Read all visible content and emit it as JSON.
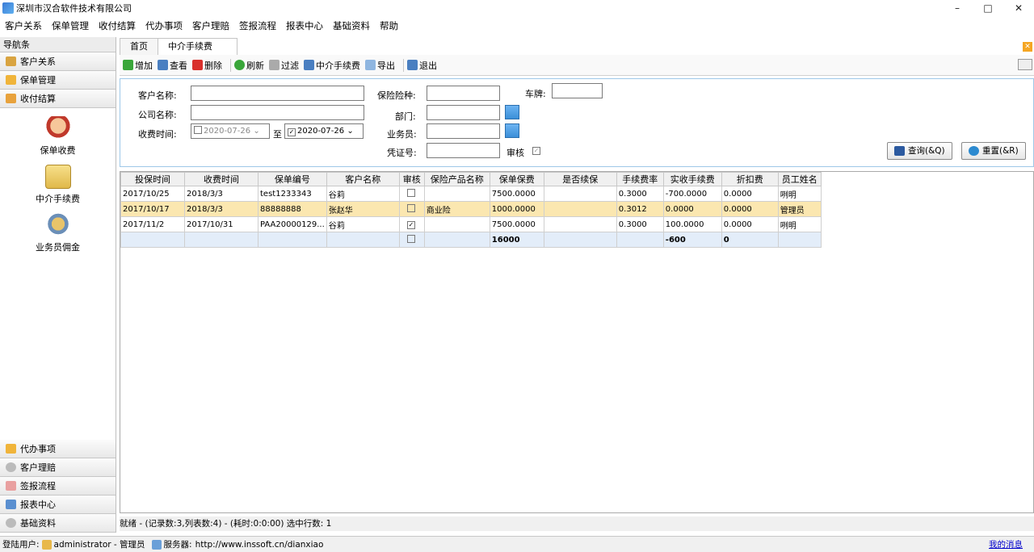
{
  "window": {
    "title": "深圳市汉合软件技术有限公司",
    "min": "–",
    "max": "□",
    "close": "✕"
  },
  "menu": [
    "客户关系",
    "保单管理",
    "收付结算",
    "代办事项",
    "客户理赔",
    "签报流程",
    "报表中心",
    "基础资料",
    "帮助"
  ],
  "nav": {
    "header": "导航条",
    "top_groups": [
      "客户关系",
      "保单管理",
      "收付结算"
    ],
    "sub_items": [
      "保单收费",
      "中介手续费",
      "业务员佣金"
    ],
    "bottom_groups": [
      "代办事项",
      "客户理赔",
      "签报流程",
      "报表中心",
      "基础资料"
    ]
  },
  "tabs": [
    "首页",
    "中介手续费"
  ],
  "toolbar": {
    "add": "增加",
    "view": "查看",
    "delete": "删除",
    "refresh": "刷新",
    "filter": "过滤",
    "print": "中介手续费",
    "export": "导出",
    "exit": "退出"
  },
  "filter": {
    "customer_name": "客户名称:",
    "company_name": "公司名称:",
    "fee_time": "收费时间:",
    "date_from": "2020-07-26",
    "to": "至",
    "date_to": "2020-07-26",
    "insurance_type": "保险险种:",
    "plate": "车牌:",
    "department": "部门:",
    "salesman": "业务员:",
    "voucher": "凭证号:",
    "audit": "审核",
    "query": "查询(&Q)",
    "reset": "重置(&R)"
  },
  "grid": {
    "columns": [
      "投保时间",
      "收费时间",
      "保单编号",
      "客户名称",
      "审核",
      "保险产品名称",
      "保单保费",
      "是否续保",
      "手续费率",
      "实收手续费",
      "折扣费",
      "员工姓名"
    ],
    "rows": [
      [
        "2017/10/25",
        "2018/3/3",
        "test1233343",
        "谷莉",
        "",
        "",
        "7500.0000",
        "",
        "0.3000",
        "-700.0000",
        "0.0000",
        "咧明"
      ],
      [
        "2017/10/17",
        "2018/3/3",
        "88888888",
        "张赵华",
        "",
        "商业险",
        "1000.0000",
        "",
        "0.3012",
        "0.0000",
        "0.0000",
        "管理员"
      ],
      [
        "2017/11/2",
        "2017/10/31",
        "PAA20000129...",
        "谷莉",
        "✓",
        "",
        "7500.0000",
        "",
        "0.3000",
        "100.0000",
        "0.0000",
        "咧明"
      ]
    ],
    "summary": [
      "",
      "",
      "",
      "",
      "",
      "",
      "16000",
      "",
      "",
      "-600",
      "0",
      ""
    ]
  },
  "status": "就绪 - (记录数:3,列表数:4) - (耗时:0:0:00) 选中行数: 1",
  "footer": {
    "login_label": "登陆用户:",
    "user": "administrator - 管理员",
    "server_label": "服务器:",
    "server": "http://www.inssoft.cn/dianxiao",
    "messages": "我的消息"
  },
  "colors": {
    "selected_row": "#fbe7b0",
    "summary_row": "#e3edf9",
    "filter_border": "#9ec8e8"
  }
}
